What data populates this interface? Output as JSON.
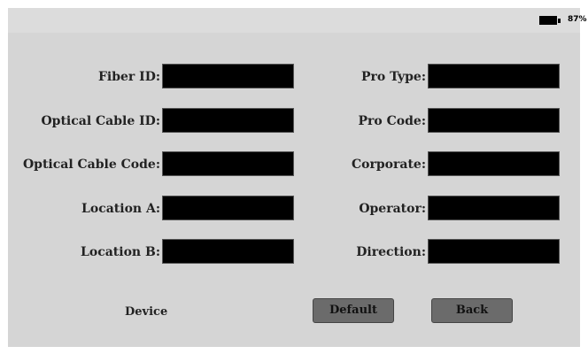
{
  "status_bar": {
    "battery_percent": "87%",
    "battery_icon": "battery-icon"
  },
  "form": {
    "left_fields": [
      {
        "label": "Fiber ID:",
        "value": ""
      },
      {
        "label": "Optical Cable ID:",
        "value": ""
      },
      {
        "label": "Optical Cable Code:",
        "value": ""
      },
      {
        "label": "Location A:",
        "value": ""
      },
      {
        "label": "Location B:",
        "value": ""
      }
    ],
    "right_fields": [
      {
        "label": "Pro Type:",
        "value": ""
      },
      {
        "label": "Pro Code:",
        "value": ""
      },
      {
        "label": "Corporate:",
        "value": ""
      },
      {
        "label": "Operator:",
        "value": ""
      },
      {
        "label": "Direction:",
        "value": ""
      }
    ]
  },
  "footer": {
    "device_label": "Device",
    "default_label": "Default",
    "back_label": "Back"
  }
}
